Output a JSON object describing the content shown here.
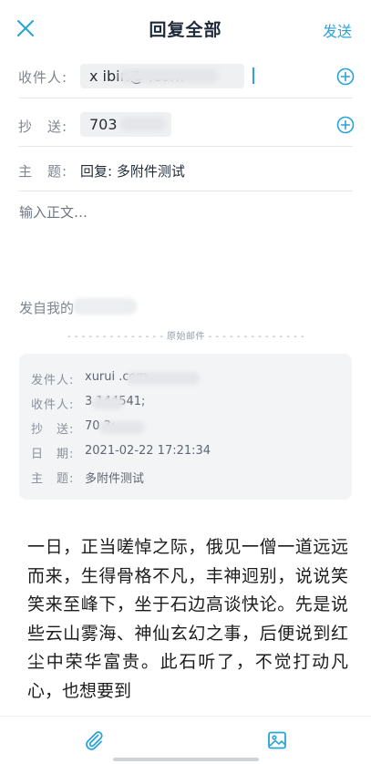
{
  "header": {
    "title": "回复全部",
    "send_label": "发送",
    "close_icon": "close-icon"
  },
  "compose": {
    "to_label": "收件人:",
    "to_value": "x     ibin@         .com",
    "cc_label": "抄　送:",
    "cc_value": "703",
    "subject_label": "主　题:",
    "subject_value": "回复: 多附件测试",
    "body_placeholder": "输入正文…",
    "signature": "发自我的"
  },
  "original": {
    "divider": "- - - - - - - - - - - - - -  原始邮件  - - - - - - - - - - - - - -",
    "fields": [
      {
        "label": "发件人:",
        "value": "xurui           .com"
      },
      {
        "label": "收件人:",
        "value": "3  144541;"
      },
      {
        "label": "抄　送:",
        "value": "70      3;"
      },
      {
        "label": "日　期:",
        "value": "2021-02-22 17:21:34"
      },
      {
        "label": "主　题:",
        "value": "多附件测试"
      }
    ]
  },
  "content": {
    "text": "一日，正当嗟悼之际，俄见一僧一道远远而来，生得骨格不凡，丰神迥别，说说笑笑来至峰下，坐于石边高谈快论。先是说些云山雾海、神仙玄幻之事，后便说到红尘中荣华富贵。此石听了，不觉打动凡心，也想要到"
  },
  "toolbar": {
    "attachment_icon": "paperclip-icon",
    "image_icon": "image-icon"
  },
  "colors": {
    "accent": "#2aa3d6",
    "text": "#1f2a3a",
    "muted": "#7d8590",
    "chip_bg": "#eef0f2",
    "card_bg": "#f3f4f6"
  }
}
